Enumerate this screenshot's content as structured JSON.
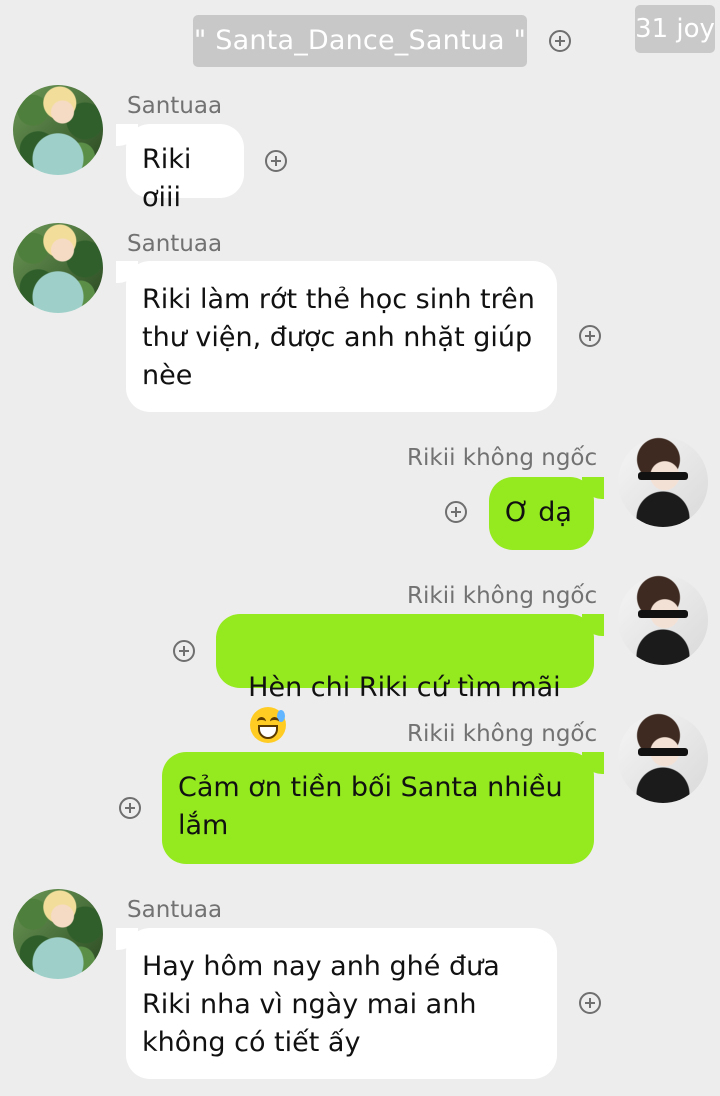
{
  "header": {
    "chat_title": "\" Santa_Dance_Santua \"",
    "badge_text": "31 joy"
  },
  "messages": [
    {
      "side": "left",
      "sender": "Santuaa",
      "text": "Riki ơiii"
    },
    {
      "side": "left",
      "sender": "Santuaa",
      "text": "Riki làm rớt thẻ học sinh trên\nthư viện, được anh nhặt giúp\nnèe"
    },
    {
      "side": "right",
      "sender": "Rikii không ngốc",
      "text": "Ơ dạ"
    },
    {
      "side": "right",
      "sender": "Rikii không ngốc",
      "text": "Hèn chi Riki cứ tìm mãi",
      "emoji": "grinning-face-with-sweat-emoji"
    },
    {
      "side": "right",
      "sender": "Rikii không ngốc",
      "text": "Cảm ơn tiền bối Santa nhiều\nlắm"
    },
    {
      "side": "left",
      "sender": "Santuaa",
      "text": "Hay hôm nay anh ghé đưa\nRiki nha vì ngày mai anh\nkhông có tiết ấy"
    }
  ],
  "colors": {
    "background": "#ededed",
    "left_bubble": "#ffffff",
    "right_bubble": "#95e91f",
    "sender_text": "#727272"
  },
  "icons": {
    "add_reaction": "plus-circle-icon"
  }
}
